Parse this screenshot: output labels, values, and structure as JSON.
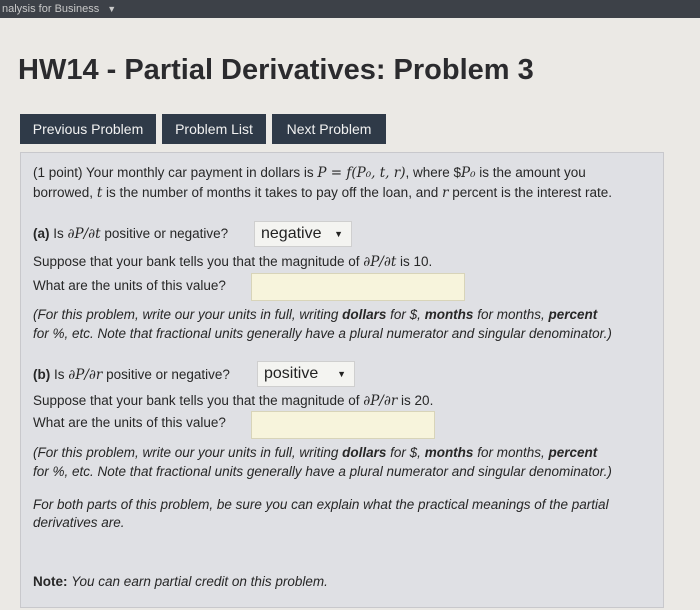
{
  "course_menu": {
    "label": "nalysis for Business"
  },
  "page_title": "HW14 - Partial Derivatives: Problem 3",
  "nav": {
    "previous": "Previous Problem",
    "list": "Problem List",
    "next": "Next Problem"
  },
  "problem": {
    "points": "(1 point)",
    "intro_1a": "Your monthly car payment in dollars is",
    "intro_formula": "P = f(P₀, t, r)",
    "intro_1b": ", where $",
    "intro_var": "P₀",
    "intro_1c": " is the amount you",
    "intro_2a": "borrowed,",
    "intro_t": "t",
    "intro_2b": "is the number of months it takes to pay off the loan, and",
    "intro_r": "r",
    "intro_2c": "percent is the interest rate.",
    "part_a": {
      "tag": "(a)",
      "q_prefix": "Is",
      "deriv": "∂P/∂t",
      "q_suffix": "positive or negative?",
      "selected": "negative",
      "magnitude_prefix": "Suppose that your bank tells you that the magnitude of",
      "magnitude_deriv": "∂P/∂t",
      "magnitude_suffix": "is 10.",
      "units_q": "What are the units of this value?",
      "units_value": "",
      "hint_1a": "(For this problem, write our your units in full, writing",
      "hint_dollars": "dollars",
      "hint_1b": "for $,",
      "hint_months": "months",
      "hint_1c": "for months,",
      "hint_percent": "percent",
      "hint_2": "for %, etc. Note that fractional units generally have a plural numerator and singular denominator.)"
    },
    "part_b": {
      "tag": "(b)",
      "q_prefix": "Is",
      "deriv": "∂P/∂r",
      "q_suffix": "positive or negative?",
      "selected": "positive",
      "magnitude_prefix": "Suppose that your bank tells you that the magnitude of",
      "magnitude_deriv": "∂P/∂r",
      "magnitude_suffix": "is 20.",
      "units_q": "What are the units of this value?",
      "units_value": "",
      "hint_1a": "(For this problem, write our your units in full, writing",
      "hint_dollars": "dollars",
      "hint_1b": "for $,",
      "hint_months": "months",
      "hint_1c": "for months,",
      "hint_percent": "percent",
      "hint_2": "for %, etc. Note that fractional units generally have a plural numerator and singular denominator.)"
    },
    "both_1": "For both parts of this problem, be sure you can explain what the practical meanings of the partial",
    "both_2": "derivatives are.",
    "note_label": "Note:",
    "note_text": "You can earn partial credit on this problem."
  }
}
